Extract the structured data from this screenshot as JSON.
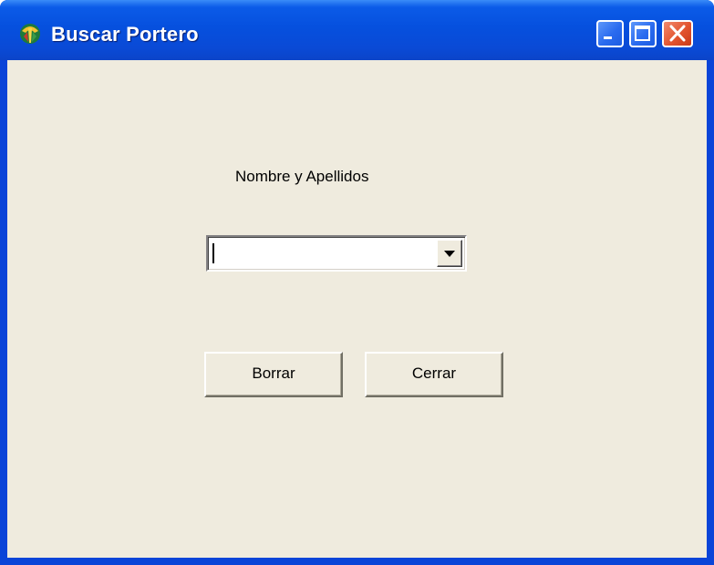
{
  "window": {
    "title": "Buscar Portero",
    "app_icon": "app-logo-icon",
    "controls": {
      "minimize_icon": "minimize-icon",
      "maximize_icon": "maximize-icon",
      "close_icon": "close-icon"
    }
  },
  "form": {
    "name_label": "Nombre y Apellidos",
    "name_combo": {
      "value": "",
      "arrow_icon": "chevron-down-icon"
    },
    "buttons": {
      "clear_label": "Borrar",
      "close_label": "Cerrar"
    }
  },
  "colors": {
    "titlebar": "#0650DE",
    "client_background": "#EFEBDE",
    "close_button": "#E2542F"
  }
}
